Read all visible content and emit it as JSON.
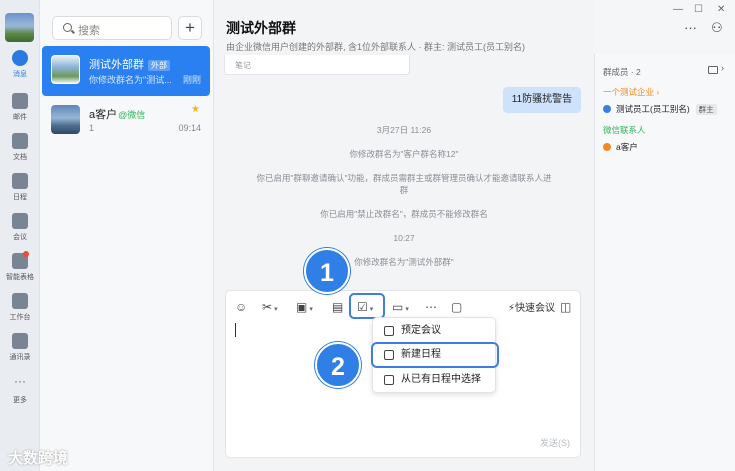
{
  "rail": {
    "items": [
      {
        "label": "消息",
        "icon": "chat-bubble-icon"
      },
      {
        "label": "邮件",
        "icon": "mail-icon"
      },
      {
        "label": "文档",
        "icon": "document-icon"
      },
      {
        "label": "日程",
        "icon": "calendar-icon"
      },
      {
        "label": "会议",
        "icon": "meeting-icon"
      },
      {
        "label": "智能表格",
        "icon": "smart-sheet-icon"
      },
      {
        "label": "工作台",
        "icon": "workbench-icon"
      },
      {
        "label": "通讯录",
        "icon": "contacts-icon"
      },
      {
        "label": "更多",
        "icon": "more-icon"
      }
    ]
  },
  "search": {
    "placeholder": "搜索"
  },
  "conversations": [
    {
      "name": "测试外部群",
      "tag": "外部",
      "preview": "你修改群名为\"测试...",
      "time": "刚刚"
    },
    {
      "name": "a客户",
      "tag": "@微信",
      "preview": "1",
      "time": "09:14"
    }
  ],
  "chat": {
    "title": "测试外部群",
    "subtitle": "由企业微信用户创建的外部群, 含1位外部联系人 · 群主: 测试员工(员工别名)",
    "note_label": "笔记",
    "bubble": "11防骚扰警告",
    "system_messages": [
      "3月27日 11:26",
      "你修改群名为\"客户群名称12\"",
      "你已启用\"群聊邀请确认\"功能，群成员需群主或群管理员确认才能邀请联系人进群",
      "你已启用\"禁止改群名\"，群成员不能修改群名",
      "10:27",
      "你修改群名为\"测试外部群\""
    ],
    "quick_meeting": "快速会议",
    "send": "发送(S)"
  },
  "schedule_menu": {
    "items": [
      "预定会议",
      "新建日程",
      "从已有日程中选择"
    ],
    "selected": 1
  },
  "callouts": [
    "1",
    "2"
  ],
  "members": {
    "title": "群成员 · 2",
    "enterprise_group": "一个测试企业 ›",
    "member1": "测试员工(员工别名)",
    "owner_tag": "群主",
    "wechat_group": "微信联系人",
    "member2": "a客户"
  },
  "watermark": "大数跨境",
  "colors": {
    "accent": "#2a80f0",
    "callout": "#2f7fe6",
    "orange": "#f08a24",
    "green": "#2fb35c"
  }
}
